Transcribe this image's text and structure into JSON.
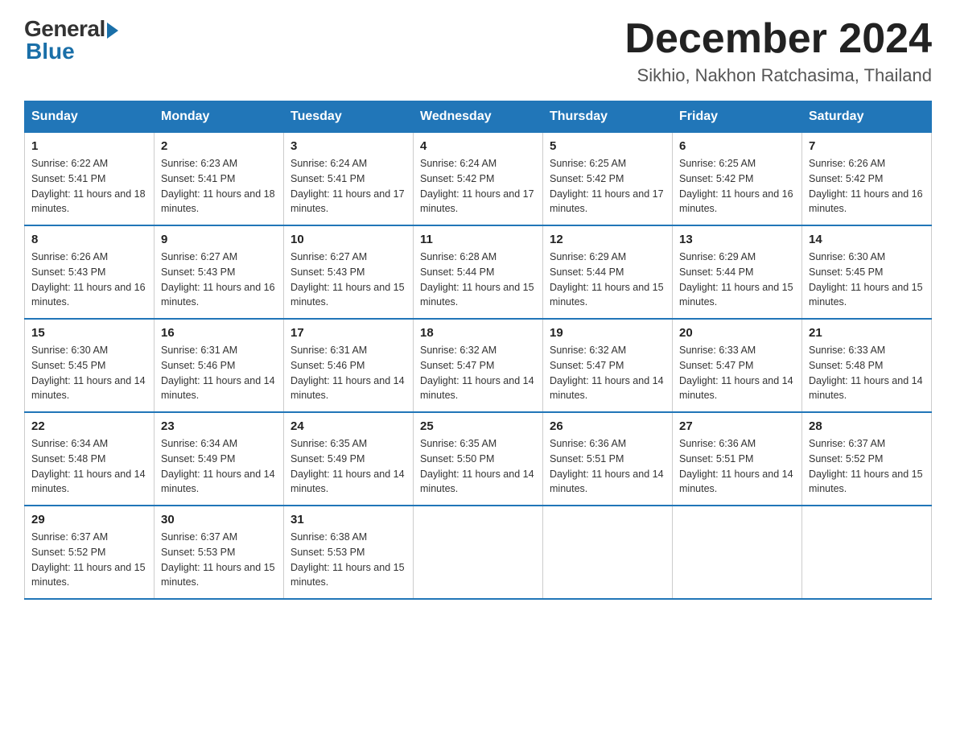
{
  "header": {
    "logo_general": "General",
    "logo_blue": "Blue",
    "month_title": "December 2024",
    "location": "Sikhio, Nakhon Ratchasima, Thailand"
  },
  "weekdays": [
    "Sunday",
    "Monday",
    "Tuesday",
    "Wednesday",
    "Thursday",
    "Friday",
    "Saturday"
  ],
  "weeks": [
    [
      {
        "day": "1",
        "sunrise": "6:22 AM",
        "sunset": "5:41 PM",
        "daylight": "11 hours and 18 minutes."
      },
      {
        "day": "2",
        "sunrise": "6:23 AM",
        "sunset": "5:41 PM",
        "daylight": "11 hours and 18 minutes."
      },
      {
        "day": "3",
        "sunrise": "6:24 AM",
        "sunset": "5:41 PM",
        "daylight": "11 hours and 17 minutes."
      },
      {
        "day": "4",
        "sunrise": "6:24 AM",
        "sunset": "5:42 PM",
        "daylight": "11 hours and 17 minutes."
      },
      {
        "day": "5",
        "sunrise": "6:25 AM",
        "sunset": "5:42 PM",
        "daylight": "11 hours and 17 minutes."
      },
      {
        "day": "6",
        "sunrise": "6:25 AM",
        "sunset": "5:42 PM",
        "daylight": "11 hours and 16 minutes."
      },
      {
        "day": "7",
        "sunrise": "6:26 AM",
        "sunset": "5:42 PM",
        "daylight": "11 hours and 16 minutes."
      }
    ],
    [
      {
        "day": "8",
        "sunrise": "6:26 AM",
        "sunset": "5:43 PM",
        "daylight": "11 hours and 16 minutes."
      },
      {
        "day": "9",
        "sunrise": "6:27 AM",
        "sunset": "5:43 PM",
        "daylight": "11 hours and 16 minutes."
      },
      {
        "day": "10",
        "sunrise": "6:27 AM",
        "sunset": "5:43 PM",
        "daylight": "11 hours and 15 minutes."
      },
      {
        "day": "11",
        "sunrise": "6:28 AM",
        "sunset": "5:44 PM",
        "daylight": "11 hours and 15 minutes."
      },
      {
        "day": "12",
        "sunrise": "6:29 AM",
        "sunset": "5:44 PM",
        "daylight": "11 hours and 15 minutes."
      },
      {
        "day": "13",
        "sunrise": "6:29 AM",
        "sunset": "5:44 PM",
        "daylight": "11 hours and 15 minutes."
      },
      {
        "day": "14",
        "sunrise": "6:30 AM",
        "sunset": "5:45 PM",
        "daylight": "11 hours and 15 minutes."
      }
    ],
    [
      {
        "day": "15",
        "sunrise": "6:30 AM",
        "sunset": "5:45 PM",
        "daylight": "11 hours and 14 minutes."
      },
      {
        "day": "16",
        "sunrise": "6:31 AM",
        "sunset": "5:46 PM",
        "daylight": "11 hours and 14 minutes."
      },
      {
        "day": "17",
        "sunrise": "6:31 AM",
        "sunset": "5:46 PM",
        "daylight": "11 hours and 14 minutes."
      },
      {
        "day": "18",
        "sunrise": "6:32 AM",
        "sunset": "5:47 PM",
        "daylight": "11 hours and 14 minutes."
      },
      {
        "day": "19",
        "sunrise": "6:32 AM",
        "sunset": "5:47 PM",
        "daylight": "11 hours and 14 minutes."
      },
      {
        "day": "20",
        "sunrise": "6:33 AM",
        "sunset": "5:47 PM",
        "daylight": "11 hours and 14 minutes."
      },
      {
        "day": "21",
        "sunrise": "6:33 AM",
        "sunset": "5:48 PM",
        "daylight": "11 hours and 14 minutes."
      }
    ],
    [
      {
        "day": "22",
        "sunrise": "6:34 AM",
        "sunset": "5:48 PM",
        "daylight": "11 hours and 14 minutes."
      },
      {
        "day": "23",
        "sunrise": "6:34 AM",
        "sunset": "5:49 PM",
        "daylight": "11 hours and 14 minutes."
      },
      {
        "day": "24",
        "sunrise": "6:35 AM",
        "sunset": "5:49 PM",
        "daylight": "11 hours and 14 minutes."
      },
      {
        "day": "25",
        "sunrise": "6:35 AM",
        "sunset": "5:50 PM",
        "daylight": "11 hours and 14 minutes."
      },
      {
        "day": "26",
        "sunrise": "6:36 AM",
        "sunset": "5:51 PM",
        "daylight": "11 hours and 14 minutes."
      },
      {
        "day": "27",
        "sunrise": "6:36 AM",
        "sunset": "5:51 PM",
        "daylight": "11 hours and 14 minutes."
      },
      {
        "day": "28",
        "sunrise": "6:37 AM",
        "sunset": "5:52 PM",
        "daylight": "11 hours and 15 minutes."
      }
    ],
    [
      {
        "day": "29",
        "sunrise": "6:37 AM",
        "sunset": "5:52 PM",
        "daylight": "11 hours and 15 minutes."
      },
      {
        "day": "30",
        "sunrise": "6:37 AM",
        "sunset": "5:53 PM",
        "daylight": "11 hours and 15 minutes."
      },
      {
        "day": "31",
        "sunrise": "6:38 AM",
        "sunset": "5:53 PM",
        "daylight": "11 hours and 15 minutes."
      },
      null,
      null,
      null,
      null
    ]
  ]
}
